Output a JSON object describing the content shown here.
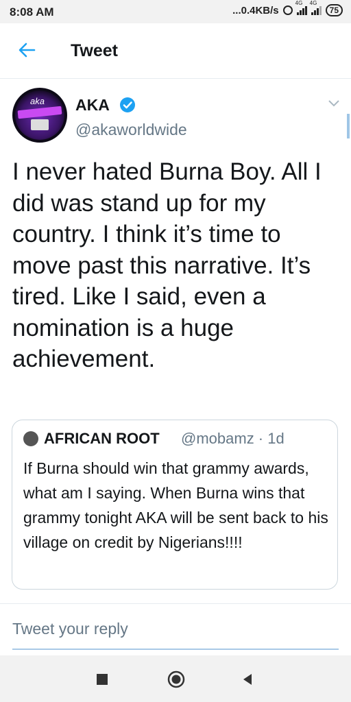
{
  "status_bar": {
    "time": "8:08 AM",
    "speed": "...0.4KB/s",
    "net1": "4G",
    "net2": "4G",
    "battery": "75"
  },
  "header": {
    "title": "Tweet"
  },
  "tweet": {
    "name": "AKA",
    "handle": "@akaworldwide",
    "text": "I never hated Burna Boy. All I did was stand up for my country. I think it’s time to move past this narrative. It’s tired. Like I said, even a nomination is a huge achievement.",
    "avatar_text": "aka"
  },
  "quoted_tweet": {
    "name": "AFRICAN ROOT",
    "handle_time": "@mobamz · 1d",
    "text": "If Burna should win that grammy awards, what am I saying. When Burna wins that grammy tonight AKA will be sent back to his village on credit by Nigerians!!!!"
  },
  "reply": {
    "placeholder": "Tweet your reply"
  },
  "colors": {
    "accent": "#1da1f2",
    "secondary_text": "#657786",
    "border": "#ccd6dd"
  },
  "icons": {
    "back": "arrow-left-icon",
    "verified": "verified-badge-icon",
    "more": "chevron-down-icon",
    "nav_recent": "square-icon",
    "nav_home": "circle-icon",
    "nav_back": "triangle-icon"
  }
}
